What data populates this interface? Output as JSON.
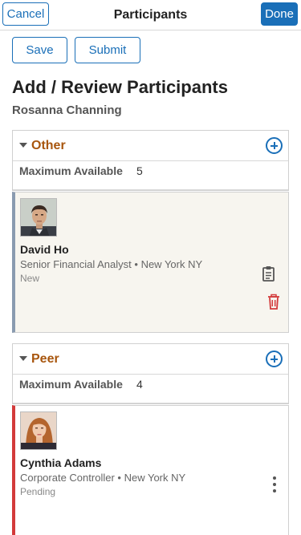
{
  "header": {
    "cancel_label": "Cancel",
    "title": "Participants",
    "done_label": "Done"
  },
  "toolbar": {
    "save_label": "Save",
    "submit_label": "Submit"
  },
  "page": {
    "heading": "Add / Review Participants",
    "person": "Rosanna Channing"
  },
  "groups": [
    {
      "title": "Other",
      "max_label": "Maximum Available",
      "max_value": "5",
      "participant": {
        "name": "David Ho",
        "job": "Senior Financial Analyst",
        "separator": "•",
        "location": "New York NY",
        "status": "New",
        "actions": [
          "clipboard-icon",
          "trash-icon"
        ]
      }
    },
    {
      "title": "Peer",
      "max_label": "Maximum Available",
      "max_value": "4",
      "participant": {
        "name": "Cynthia Adams",
        "job": "Corporate Controller",
        "separator": "•",
        "location": "New York NY",
        "status": "Pending",
        "actions": [
          "more-vertical-icon"
        ]
      }
    }
  ],
  "colors": {
    "accent": "#1a6fb8",
    "group_title": "#a8560e",
    "delete": "#d33a3a",
    "peer_bar": "#d33a3a",
    "other_bar": "#8a9bb0"
  }
}
